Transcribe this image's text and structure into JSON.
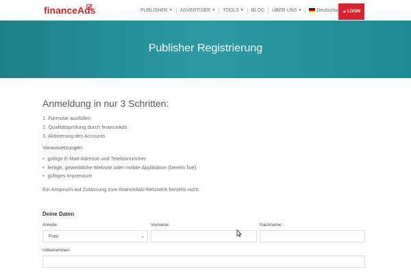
{
  "header": {
    "logo_text": "financeAds",
    "nav": [
      "PUBLISHER",
      "ADVERTISER",
      "TOOLS",
      "BLOG",
      "ÜBER UNS",
      "Deutschland"
    ],
    "login_label": "LOGIN",
    "brand_color": "#c0272d",
    "login_color": "#d9232f"
  },
  "hero": {
    "title": "Publisher Registrierung",
    "color": "#2a9aa4"
  },
  "content": {
    "heading": "Anmeldung in nur 3 Schritten:",
    "steps": [
      "1. Formular ausfüllen",
      "2. Qualitätsprüfung durch financeAds",
      "3. Aktivierung des Accounts"
    ],
    "requirements_title": "Voraussetzungen:",
    "requirements": [
      "gültige E-Mail-Adresse und Telefonnummer",
      "fertige, gewerbliche Website oder mobile Applikation (bereits live)",
      "gültiges Impressum"
    ],
    "claim_note": "Ein Anspruch auf Zulassung zum financeAds-Netzwerk besteht nicht."
  },
  "form": {
    "section_title": "Deine Daten",
    "salutation_label": "Anrede:",
    "salutation_value": "Frau",
    "firstname_label": "Vorname:",
    "lastname_label": "Nachname:",
    "company_label": "Unternehmen:"
  }
}
